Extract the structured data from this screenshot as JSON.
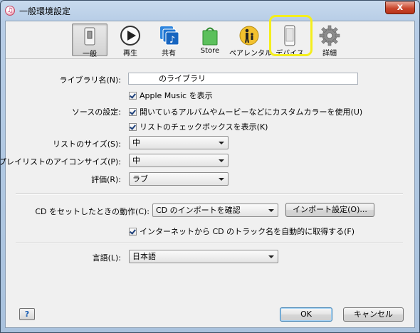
{
  "window": {
    "title": "一般環境設定",
    "close_glyph": "x"
  },
  "toolbar": {
    "items": [
      {
        "label": "一般",
        "icon": "general-switch-icon",
        "selected": true
      },
      {
        "label": "再生",
        "icon": "play-icon"
      },
      {
        "label": "共有",
        "icon": "sharing-music-icon"
      },
      {
        "label": "Store",
        "icon": "store-bag-icon"
      },
      {
        "label": "ペアレンタル",
        "icon": "parental-icon"
      },
      {
        "label": "デバイス",
        "icon": "device-phone-icon",
        "highlighted": true
      },
      {
        "label": "詳細",
        "icon": "gear-icon"
      }
    ],
    "highlight_color": "#f4ee1d"
  },
  "general": {
    "library_name_label": "ライブラリ名(N):",
    "library_name_value": "のライブラリ",
    "apple_music_label": "Apple Music を表示",
    "source_settings_label": "ソースの設定:",
    "custom_color_label": "開いているアルバムやムービーなどにカスタムカラーを使用(U)",
    "list_checkbox_label": "リストのチェックボックスを表示(K)",
    "list_size_label": "リストのサイズ(S):",
    "list_size_value": "中",
    "playlist_icon_size_label": "プレイリストのアイコンサイズ(P):",
    "playlist_icon_size_value": "中",
    "rating_label": "評価(R):",
    "rating_value": "ラブ",
    "cd_action_label": "CD をセットしたときの動作(C):",
    "cd_action_value": "CD のインポートを確認",
    "import_settings_button": "インポート設定(O)...",
    "track_names_label": "インターネットから CD のトラック名を自動的に取得する(F)",
    "language_label": "言語(L):",
    "language_value": "日本語"
  },
  "footer": {
    "help": "?",
    "ok": "OK",
    "cancel": "キャンセル"
  }
}
